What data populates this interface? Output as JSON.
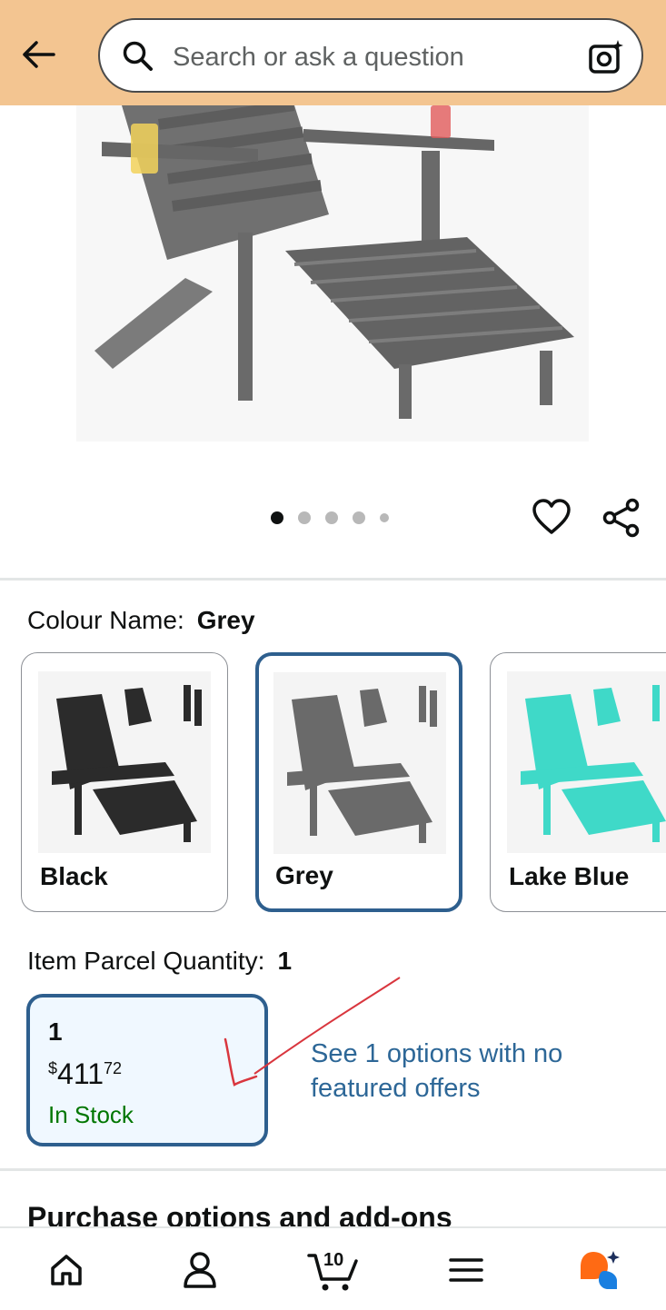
{
  "header": {
    "search_placeholder": "Search or ask a question"
  },
  "carousel": {
    "total_images": 5,
    "active_index": 0
  },
  "colour": {
    "label": "Colour Name:",
    "selected": "Grey",
    "options": [
      {
        "name": "Black",
        "color": "#2b2b2b"
      },
      {
        "name": "Grey",
        "color": "#6a6a6a"
      },
      {
        "name": "Lake Blue",
        "color": "#3fd9c8"
      }
    ]
  },
  "quantity": {
    "label": "Item Parcel Quantity:",
    "selected": "1",
    "card": {
      "qty": "1",
      "currency": "$",
      "price_whole": "411",
      "price_cents": "72",
      "stock": "In Stock"
    },
    "see_options": "See 1 options with no featured offers"
  },
  "section": {
    "purchase_title": "Purchase options and add-ons"
  },
  "bottom_nav": {
    "cart_count": "10",
    "items": [
      "home-icon",
      "account-icon",
      "cart-icon",
      "menu-icon",
      "rufus-icon"
    ]
  },
  "colors": {
    "header_bg": "#f3c591",
    "selected_border": "#2e5f8e",
    "link": "#2d6797",
    "in_stock": "#007600"
  }
}
